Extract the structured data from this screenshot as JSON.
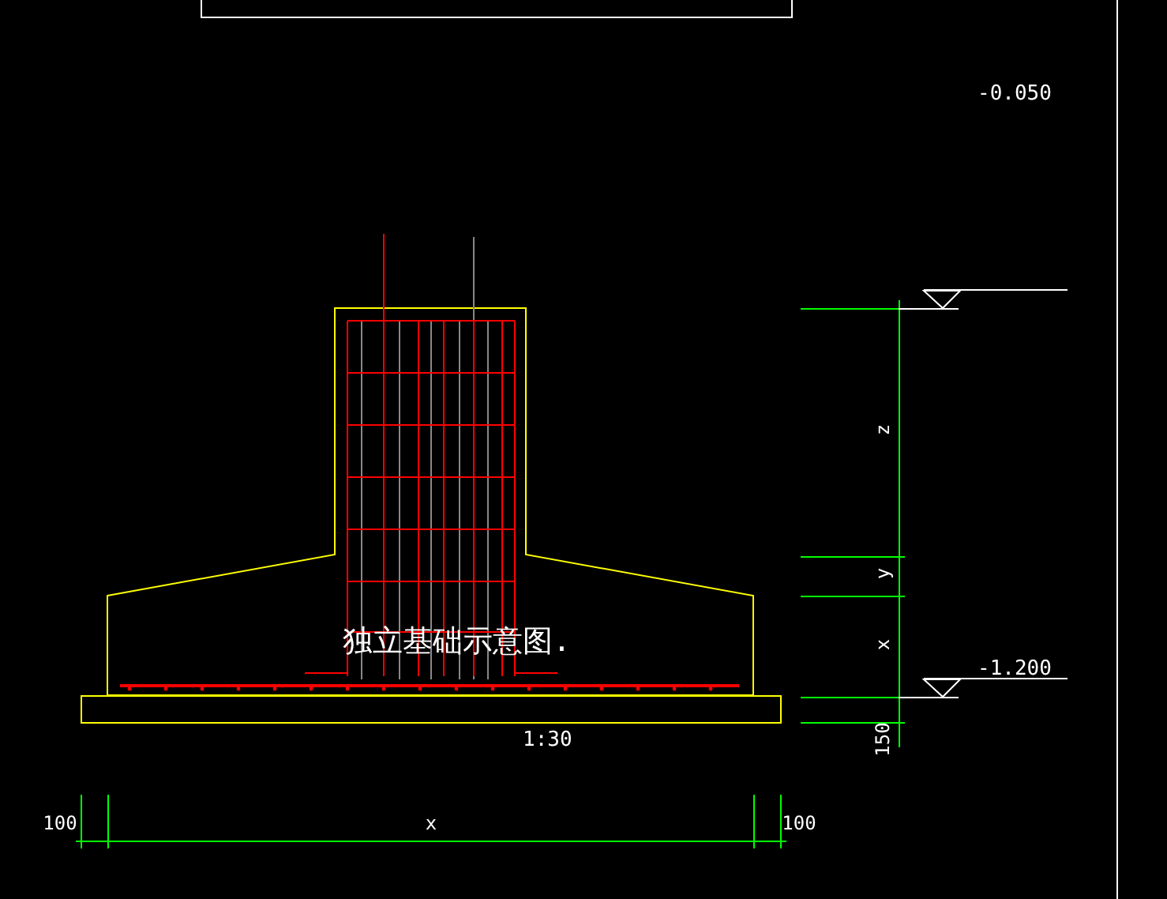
{
  "drawing": {
    "title": "独立基础示意图.",
    "scale": "1:30",
    "elevations": [
      {
        "label": "-0.050"
      },
      {
        "label": "-1.200"
      }
    ],
    "vertical_dims": [
      {
        "label": "z"
      },
      {
        "label": "y"
      },
      {
        "label": "x"
      },
      {
        "label": "150"
      }
    ],
    "bottom_dims": [
      {
        "label": "100"
      },
      {
        "label": "x"
      },
      {
        "label": "100"
      }
    ]
  }
}
